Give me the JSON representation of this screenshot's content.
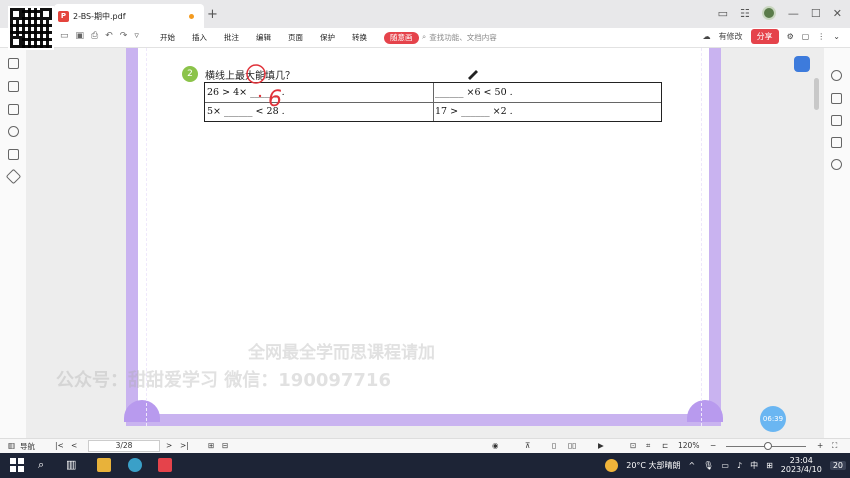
{
  "window": {
    "tab_title": "2-BS-期中.pdf",
    "pdf_icon_glyph": "P",
    "new_tab_glyph": "+",
    "controls": [
      "▭",
      "☷",
      "—",
      "☐",
      "✕"
    ]
  },
  "toolbar": {
    "menu": [
      "开始",
      "插入",
      "批注",
      "编辑",
      "页面",
      "保护",
      "转换"
    ],
    "highlight_menu": "随意画",
    "search_placeholder": "查找功能、文档内容",
    "edit_label": "有修改",
    "share_label": "分享"
  },
  "document": {
    "question_number": "2",
    "question_title": "横线上最大能填几？",
    "rows": [
      [
        "26 > 4× ______ .",
        "______ ×6 < 50 ."
      ],
      [
        "5× ______ < 28 .",
        "17 > ______ ×2 ."
      ]
    ],
    "handwritten_answer": "6",
    "watermark_line1": "全网最全学而思课程请加",
    "watermark_line2": "公众号：甜甜爱学习  微信：190097716"
  },
  "statusbar": {
    "nav_label": "导航",
    "page_indicator": "3/28",
    "zoom_level": "120%",
    "zoom_minus": "−",
    "zoom_plus": "+"
  },
  "timer": "06:39",
  "taskbar": {
    "weather": "20°C  大部晴朗",
    "ime": "中",
    "time": "23:04",
    "date": "2023/4/10",
    "notification_count": "20"
  },
  "colors": {
    "accent_red": "#e5434b",
    "page_border": "#c9b3f0",
    "question_badge": "#8bc34a",
    "annotation_red": "#e0323a"
  }
}
